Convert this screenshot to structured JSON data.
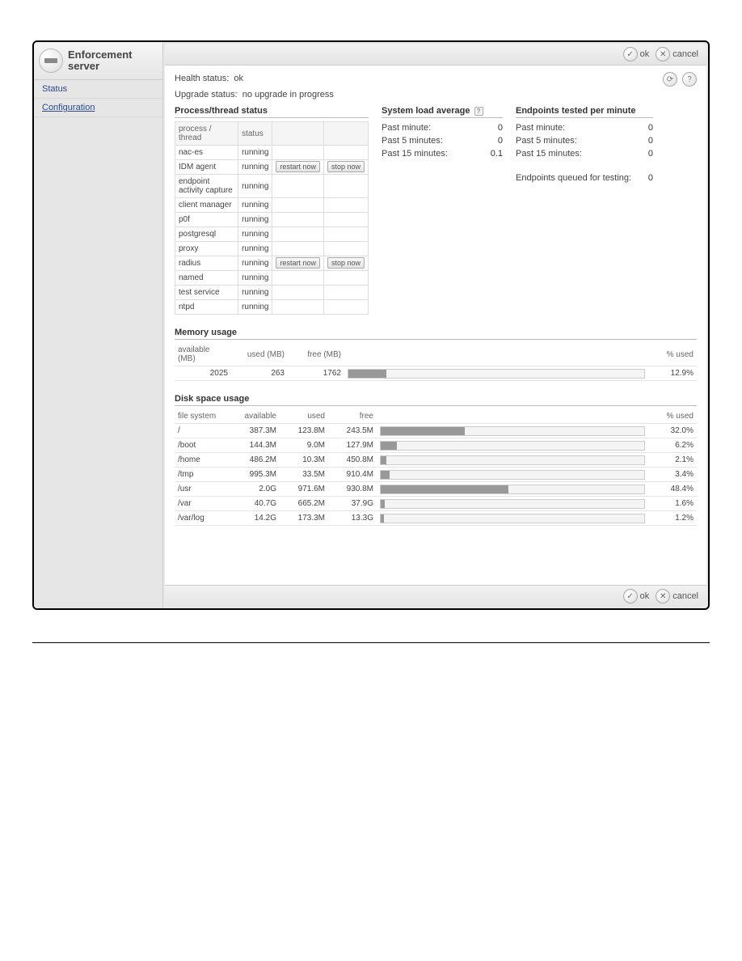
{
  "sidebar": {
    "title_line1": "Enforcement",
    "title_line2": "server",
    "items": [
      {
        "label": "Status"
      },
      {
        "label": "Configuration"
      }
    ]
  },
  "buttons": {
    "ok": "ok",
    "cancel": "cancel",
    "restart_now": "restart now",
    "stop_now": "stop now"
  },
  "health": {
    "label": "Health status:",
    "value": "ok"
  },
  "upgrade": {
    "label": "Upgrade status:",
    "value": "no upgrade in progress"
  },
  "process_section": {
    "title": "Process/thread status",
    "col_process": "process / thread",
    "col_status": "status",
    "rows": [
      {
        "name": "nac-es",
        "status": "running",
        "restart": false,
        "stop": false
      },
      {
        "name": "IDM agent",
        "status": "running",
        "restart": true,
        "stop": true
      },
      {
        "name": "endpoint activity capture",
        "status": "running",
        "restart": false,
        "stop": false
      },
      {
        "name": "client manager",
        "status": "running",
        "restart": false,
        "stop": false
      },
      {
        "name": "p0f",
        "status": "running",
        "restart": false,
        "stop": false
      },
      {
        "name": "postgresql",
        "status": "running",
        "restart": false,
        "stop": false
      },
      {
        "name": "proxy",
        "status": "running",
        "restart": false,
        "stop": false
      },
      {
        "name": "radius",
        "status": "running",
        "restart": true,
        "stop": true
      },
      {
        "name": "named",
        "status": "running",
        "restart": false,
        "stop": false
      },
      {
        "name": "test service",
        "status": "running",
        "restart": false,
        "stop": false
      },
      {
        "name": "ntpd",
        "status": "running",
        "restart": false,
        "stop": false
      }
    ]
  },
  "load_section": {
    "title": "System load average",
    "rows": [
      {
        "label": "Past minute:",
        "value": "0"
      },
      {
        "label": "Past 5 minutes:",
        "value": "0"
      },
      {
        "label": "Past 15 minutes:",
        "value": "0.1"
      }
    ]
  },
  "epm_section": {
    "title": "Endpoints tested per minute",
    "rows": [
      {
        "label": "Past minute:",
        "value": "0"
      },
      {
        "label": "Past 5 minutes:",
        "value": "0"
      },
      {
        "label": "Past 15 minutes:",
        "value": "0"
      }
    ],
    "queued_label": "Endpoints queued for testing:",
    "queued_value": "0"
  },
  "memory_section": {
    "title": "Memory usage",
    "col_available": "available (MB)",
    "col_used": "used (MB)",
    "col_free": "free (MB)",
    "col_pct": "% used",
    "row": {
      "available": "2025",
      "used": "263",
      "free": "1762",
      "pct": "12.9%",
      "pct_num": 12.9
    }
  },
  "disk_section": {
    "title": "Disk space usage",
    "col_fs": "file system",
    "col_available": "available",
    "col_used": "used",
    "col_free": "free",
    "col_pct": "% used",
    "rows": [
      {
        "fs": "/",
        "available": "387.3M",
        "used": "123.8M",
        "free": "243.5M",
        "pct": "32.0%",
        "pct_num": 32.0
      },
      {
        "fs": "/boot",
        "available": "144.3M",
        "used": "9.0M",
        "free": "127.9M",
        "pct": "6.2%",
        "pct_num": 6.2
      },
      {
        "fs": "/home",
        "available": "486.2M",
        "used": "10.3M",
        "free": "450.8M",
        "pct": "2.1%",
        "pct_num": 2.1
      },
      {
        "fs": "/tmp",
        "available": "995.3M",
        "used": "33.5M",
        "free": "910.4M",
        "pct": "3.4%",
        "pct_num": 3.4
      },
      {
        "fs": "/usr",
        "available": "2.0G",
        "used": "971.6M",
        "free": "930.8M",
        "pct": "48.4%",
        "pct_num": 48.4
      },
      {
        "fs": "/var",
        "available": "40.7G",
        "used": "665.2M",
        "free": "37.9G",
        "pct": "1.6%",
        "pct_num": 1.6
      },
      {
        "fs": "/var/log",
        "available": "14.2G",
        "used": "173.3M",
        "free": "13.3G",
        "pct": "1.2%",
        "pct_num": 1.2
      }
    ]
  }
}
